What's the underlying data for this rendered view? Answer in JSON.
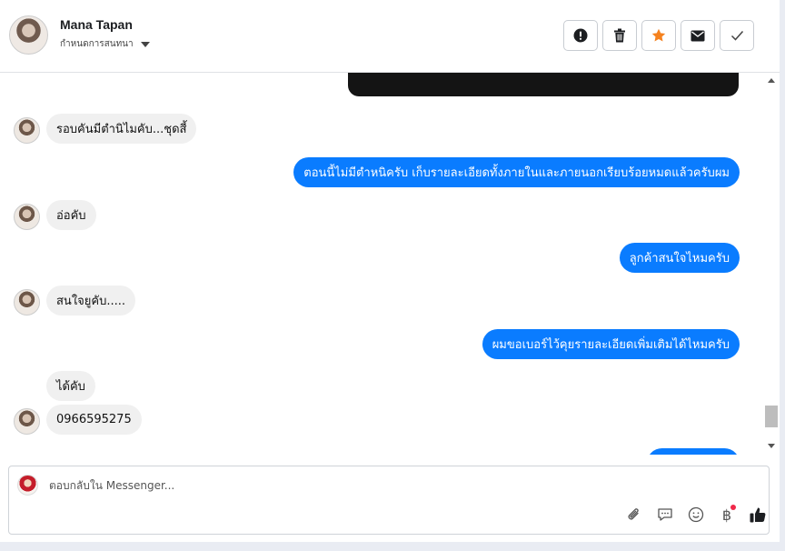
{
  "header": {
    "contact_name": "Mana Tapan",
    "assign_label": "กำหนดการสนทนา",
    "toolbar": {
      "spam_icon": "exclamation-circle-icon",
      "delete_icon": "trash-icon",
      "star_icon": "star-icon",
      "unread_icon": "envelope-icon",
      "done_icon": "check-icon"
    }
  },
  "messages": [
    {
      "side": "in",
      "text": "รอบคันมีตำนิไมคับ...ชุดสี้"
    },
    {
      "side": "out",
      "text": "ตอนนี้ไม่มีตำหนิครับ เก็บรายละเอียดทั้งภายในและภายนอกเรียบร้อยหมดแล้วครับผม"
    },
    {
      "side": "in",
      "text": "อ่อคับ"
    },
    {
      "side": "out",
      "text": "ลูกค้าสนใจไหมครับ"
    },
    {
      "side": "in",
      "text": "สนใจยูคับ....."
    },
    {
      "side": "out",
      "text": "ผมขอเบอร์ไว้คุยรายละเอียดเพิ่มเติมได้ไหมครับ"
    },
    {
      "side": "in",
      "text": "ได้คับ"
    },
    {
      "side": "in",
      "text": "0966595275"
    }
  ],
  "composer": {
    "placeholder": "ตอบกลับใน Messenger...",
    "tools": [
      "paperclip-icon",
      "saved-reply-icon",
      "emoji-icon",
      "payment-icon",
      "thumbs-up-icon"
    ],
    "payment_symbol": "฿"
  },
  "colors": {
    "outgoing_bubble": "#0a7cff",
    "incoming_bubble": "#f0f0f0",
    "star": "#f5821f"
  }
}
